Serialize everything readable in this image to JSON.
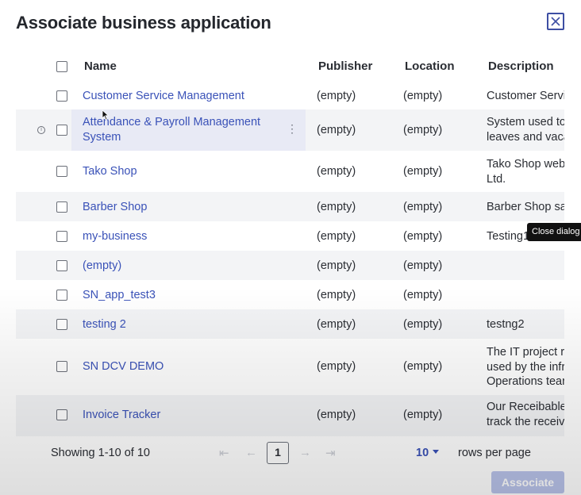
{
  "dialog": {
    "title": "Associate business application",
    "close_tooltip": "Close dialog"
  },
  "table": {
    "columns": [
      "Name",
      "Publisher",
      "Location",
      "Description"
    ],
    "rows": [
      {
        "name": "Customer Service Management",
        "publisher": "(empty)",
        "location": "(empty)",
        "description": "Customer Servi"
      },
      {
        "name": "Attendance & Payroll Management\nSystem",
        "publisher": "(empty)",
        "location": "(empty)",
        "description": "System used to\nleaves and vaca"
      },
      {
        "name": "Tako Shop",
        "publisher": "(empty)",
        "location": "(empty)",
        "description": "Tako Shop web\nLtd."
      },
      {
        "name": "Barber Shop",
        "publisher": "(empty)",
        "location": "(empty)",
        "description": "Barber Shop sa"
      },
      {
        "name": "my-business",
        "publisher": "(empty)",
        "location": "(empty)",
        "description": "Testing1"
      },
      {
        "name": "(empty)",
        "publisher": "(empty)",
        "location": "(empty)",
        "description": ""
      },
      {
        "name": "SN_app_test3",
        "publisher": "(empty)",
        "location": "(empty)",
        "description": ""
      },
      {
        "name": "testing 2",
        "publisher": "(empty)",
        "location": "(empty)",
        "description": "testng2"
      },
      {
        "name": "SN DCV DEMO",
        "publisher": "(empty)",
        "location": "(empty)",
        "description": "The IT project r\nused by the infr\nOperations tear"
      },
      {
        "name": "Invoice Tracker",
        "publisher": "(empty)",
        "location": "(empty)",
        "description": "Our Receibable\ntrack the receiv"
      }
    ]
  },
  "pagination": {
    "showing": "Showing 1-10 of 10",
    "current_page": "1",
    "rows_per_page_value": "10",
    "rows_per_page_label": "rows per page"
  },
  "actions": {
    "associate_label": "Associate"
  },
  "icons": {
    "close": "close-icon",
    "first_page": "first-page-icon",
    "prev_page": "prev-page-icon",
    "next_page": "next-page-icon",
    "last_page": "last-page-icon",
    "info": "info-icon",
    "more": "more-vertical-icon"
  },
  "colors": {
    "link": "#3a52b8",
    "button_disabled": "#b9c3ea",
    "row_alt": "#f3f4f6",
    "row_hover": "#e8eaf5"
  }
}
